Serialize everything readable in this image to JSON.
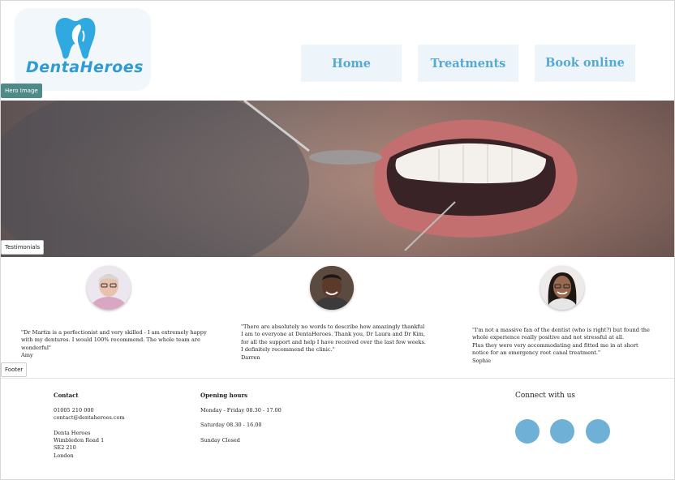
{
  "brand": {
    "logo_text": "DentaHeroes",
    "accent_color": "#2f9bd3",
    "nav_color": "#56a9d2"
  },
  "nav": {
    "home": "Home",
    "treatments": "Treatments",
    "book": "Book online"
  },
  "section_tags": {
    "hero": "Hero Image",
    "testimonials": "Testimonials",
    "footer": "Footer"
  },
  "testimonials": [
    {
      "lines": [
        "\"Dr Martin is a perfectionist and very skilled - I am extremely happy",
        "with my dentures. I would 100% recommend. The whole team are",
        "wonderful\""
      ],
      "author": "Amy"
    },
    {
      "lines": [
        "\"There are absolutely no words to describe how amazingly thankful",
        "I am to everyone at DentaHeroes. Thank you, Dr Laura and Dr Kim,",
        "for all the support and help I have received over the last few weeks.",
        "I definitely recommend the clinic.\""
      ],
      "author": "Darren"
    },
    {
      "lines": [
        "\"I'm not a massive fan of the dentist (who is right?) but found the",
        "whole experience really positive and not stressful at all.",
        "Plus they were very accommodating and fitted me in at short",
        "notice for an emergency root canal treatment.\""
      ],
      "author": "Sophie"
    }
  ],
  "footer": {
    "contact": {
      "heading": "Contact",
      "phone": "01005 210 000",
      "email": "contact@dentaheroes.com",
      "address": [
        "Denta Heroes",
        "Wimbledon Road 1",
        "SE2 210",
        "London"
      ]
    },
    "hours": {
      "heading": "Opening hours",
      "weekday": "Monday - Friday 08.30 - 17.00",
      "saturday": "Saturday 08.30 - 16.00",
      "sunday": "Sunday Closed"
    },
    "connect": "Connect with us"
  }
}
